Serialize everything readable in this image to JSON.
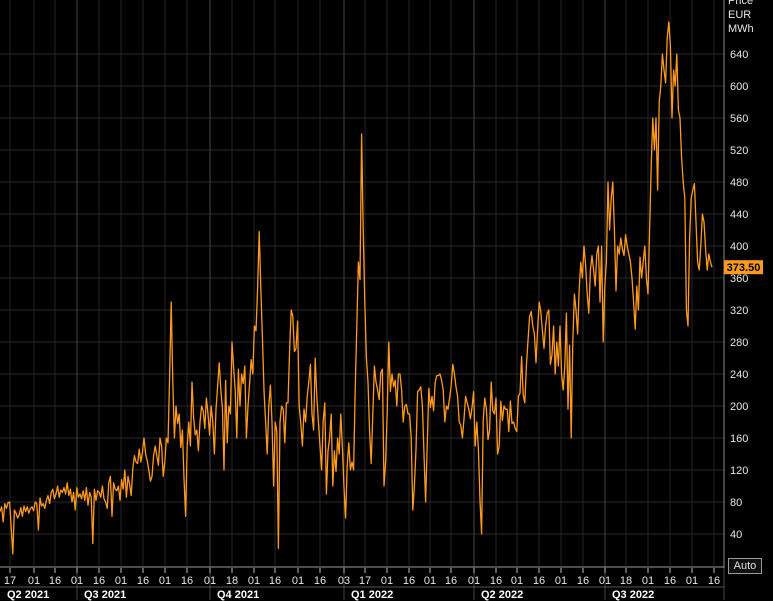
{
  "chart_data": {
    "type": "line",
    "ylabel_lines": [
      "Price",
      "EUR",
      "MWh"
    ],
    "ylim": [
      0,
      700
    ],
    "yticks": [
      40,
      80,
      120,
      160,
      200,
      240,
      280,
      320,
      360,
      400,
      440,
      480,
      520,
      560,
      600,
      640
    ],
    "x_tick_labels": [
      "17",
      "01",
      "16",
      "01",
      "16",
      "01",
      "16",
      "01",
      "16",
      "01",
      "18",
      "01",
      "16",
      "01",
      "16",
      "03",
      "17",
      "01",
      "16",
      "01",
      "16",
      "01",
      "16",
      "01",
      "16",
      "01",
      "16",
      "01",
      "18",
      "01",
      "16",
      "01",
      "16"
    ],
    "quarter_labels": [
      "Q2 2021",
      "Q3 2021",
      "Q4 2021",
      "Q1 2022",
      "Q2 2022",
      "Q3 2022"
    ],
    "last_value_label": "373.50",
    "grid": true,
    "series": [
      {
        "color": "#ff9a1c",
        "values": [
          68,
          74,
          55,
          78,
          72,
          79,
          80,
          48,
          15,
          70,
          66,
          60,
          64,
          73,
          62,
          75,
          68,
          74,
          66,
          72,
          74,
          69,
          80,
          78,
          45,
          85,
          75,
          78,
          72,
          82,
          88,
          78,
          92,
          96,
          84,
          90,
          100,
          86,
          95,
          92,
          98,
          90,
          104,
          88,
          96,
          80,
          92,
          70,
          98,
          86,
          90,
          84,
          94,
          82,
          98,
          76,
          92,
          86,
          28,
          96,
          82,
          94,
          92,
          86,
          100,
          84,
          80,
          72,
          104,
          112,
          62,
          104,
          96,
          94,
          100,
          82,
          108,
          96,
          120,
          86,
          112,
          102,
          88,
          122,
          138,
          130,
          128,
          146,
          130,
          142,
          160,
          140,
          132,
          120,
          106,
          112,
          138,
          150,
          138,
          126,
          160,
          150,
          112,
          130,
          160,
          154,
          236,
          330,
          230,
          160,
          200,
          178,
          190,
          148,
          170,
          110,
          62,
          150,
          180,
          150,
          230,
          186,
          164,
          170,
          144,
          180,
          200,
          194,
          172,
          210,
          190,
          164,
          200,
          180,
          140,
          196,
          224,
          254,
          220,
          198,
          120,
          232,
          154,
          200,
          190,
          280,
          248,
          220,
          160,
          246,
          200,
          240,
          228,
          250,
          160,
          200,
          228,
          258,
          240,
          300,
          294,
          346,
          418,
          348,
          286,
          220,
          180,
          140,
          200,
          226,
          180,
          100,
          180,
          168,
          22,
          180,
          200,
          196,
          154,
          204,
          204,
          270,
          320,
          312,
          268,
          272,
          306,
          200,
          178,
          150,
          196,
          180,
          212,
          230,
          252,
          190,
          170,
          260,
          212,
          180,
          150,
          120,
          182,
          204,
          90,
          144,
          160,
          190,
          100,
          144,
          118,
          160,
          140,
          190,
          148,
          98,
          60,
          126,
          154,
          120,
          130,
          120,
          220,
          300,
          380,
          358,
          540,
          420,
          330,
          260,
          230,
          168,
          128,
          190,
          250,
          230,
          220,
          208,
          242,
          246,
          100,
          130,
          192,
          280,
          218,
          240,
          224,
          232,
          200,
          240,
          240,
          220,
          180,
          200,
          202,
          190,
          190,
          160,
          70,
          100,
          146,
          218,
          220,
          224,
          200,
          140,
          80,
          150,
          222,
          198,
          212,
          194,
          230,
          238,
          238,
          240,
          232,
          220,
          180,
          200,
          196,
          210,
          226,
          252,
          240,
          224,
          212,
          180,
          176,
          160,
          184,
          212,
          204,
          196,
          184,
          198,
          218,
          150,
          180,
          146,
          82,
          40,
          182,
          210,
          196,
          158,
          170,
          230,
          194,
          190,
          210,
          140,
          150,
          206,
          182,
          200,
          196,
          196,
          168,
          206,
          178,
          180,
          172,
          168,
          212,
          216,
          262,
          214,
          204,
          250,
          282,
          312,
          318,
          300,
          290,
          254,
          296,
          330,
          318,
          294,
          272,
          300,
          316,
          320,
          252,
          264,
          300,
          240,
          280,
          250,
          300,
          240,
          220,
          250,
          316,
          196,
          276,
          160,
          280,
          340,
          320,
          290,
          346,
          380,
          360,
          400,
          376,
          340,
          316,
          370,
          388,
          370,
          350,
          390,
          400,
          330,
          400,
          280,
          350,
          380,
          480,
          420,
          460,
          480,
          420,
          344,
          400,
          390,
          410,
          396,
          388,
          414,
          400,
          390,
          380,
          360,
          330,
          296,
          350,
          320,
          386,
          360,
          380,
          400,
          360,
          340,
          420,
          500,
          560,
          520,
          560,
          470,
          580,
          600,
          640,
          620,
          604,
          660,
          680,
          650,
          560,
          620,
          600,
          640,
          570,
          560,
          510,
          480,
          460,
          320,
          300,
          410,
          460,
          470,
          478,
          430,
          380,
          370,
          400,
          440,
          430,
          396,
          370,
          390,
          380,
          373.5
        ]
      }
    ]
  }
}
